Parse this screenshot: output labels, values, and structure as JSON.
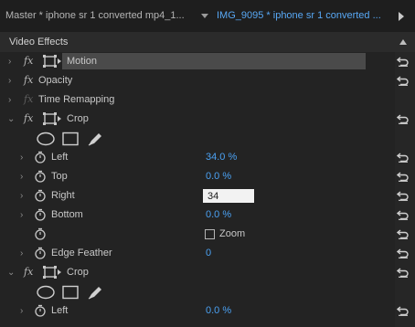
{
  "tabs": {
    "master": "Master * iphone sr 1 converted mp4_1...",
    "clip": "IMG_9095 * iphone sr 1 converted ..."
  },
  "panel": {
    "title": "Video Effects"
  },
  "effects": {
    "motion": "Motion",
    "opacity": "Opacity",
    "time_remapping": "Time Remapping",
    "crop1": "Crop",
    "crop2": "Crop"
  },
  "fx_symbol": "fx",
  "crop_params": {
    "left": {
      "label": "Left",
      "value": "34.0 %"
    },
    "top": {
      "label": "Top",
      "value": "0.0 %"
    },
    "right": {
      "label": "Right",
      "value": "34"
    },
    "bottom": {
      "label": "Bottom",
      "value": "0.0 %"
    },
    "zoom": {
      "label": "Zoom",
      "checked": false
    },
    "edge_feather": {
      "label": "Edge Feather",
      "value": "0"
    }
  },
  "crop2_params": {
    "left": {
      "label": "Left",
      "value": "0.0 %"
    }
  },
  "colors": {
    "value_blue": "#4ba1f2",
    "clip_tab_blue": "#58a8f5",
    "panel_bg": "#232323",
    "highlight_bar": "#4a4a4a"
  },
  "icons": {
    "expand": "chevron-right-icon",
    "collapse": "chevron-down-icon",
    "reset": "reset-icon",
    "stopwatch": "stopwatch-icon",
    "transform": "transform-icon",
    "ellipse_mask": "ellipse-mask-icon",
    "rect_mask": "rectangle-mask-icon",
    "pen_mask": "pen-mask-icon"
  }
}
